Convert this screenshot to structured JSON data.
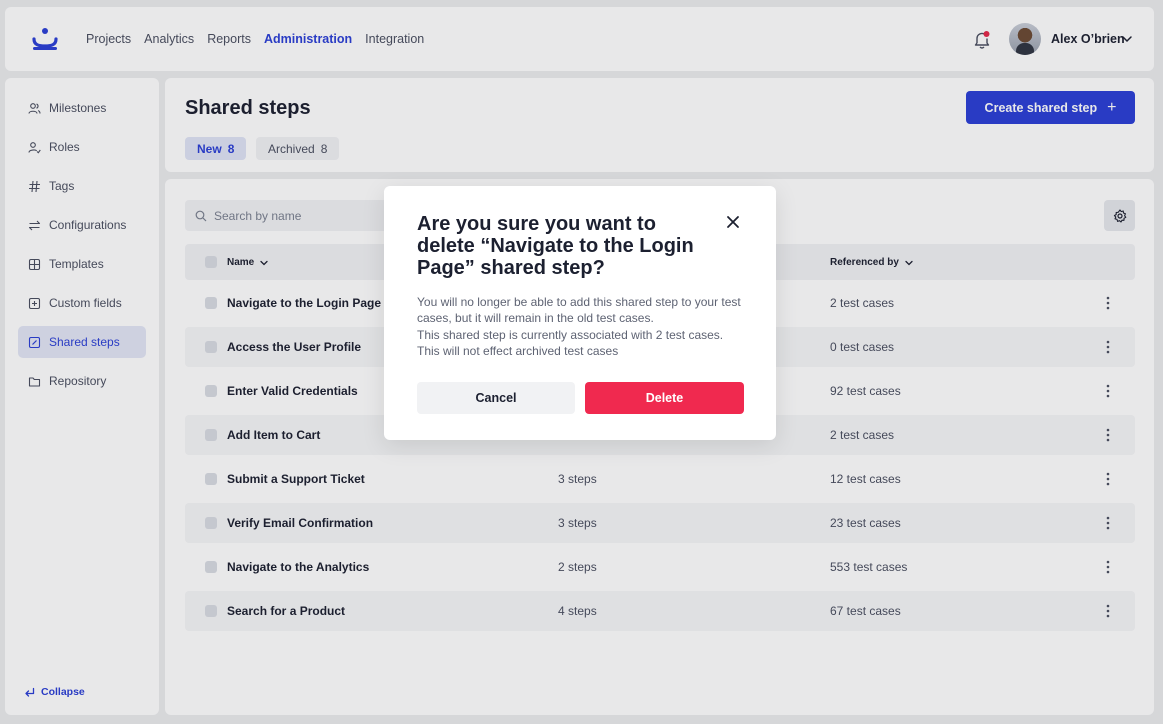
{
  "nav": {
    "items": [
      {
        "label": "Projects",
        "active": false
      },
      {
        "label": "Analytics",
        "active": false
      },
      {
        "label": "Reports",
        "active": false
      },
      {
        "label": "Administration",
        "active": true
      },
      {
        "label": "Integration",
        "active": false
      }
    ],
    "user_name": "Alex O’brien"
  },
  "sidebar": {
    "items": [
      {
        "label": "Milestones",
        "icon": "users-icon"
      },
      {
        "label": "Roles",
        "icon": "user-roles-icon"
      },
      {
        "label": "Tags",
        "icon": "hash-icon"
      },
      {
        "label": "Configurations",
        "icon": "arrows-exchange-icon"
      },
      {
        "label": "Templates",
        "icon": "layout-icon"
      },
      {
        "label": "Custom fields",
        "icon": "plus-square-icon"
      },
      {
        "label": "Shared steps",
        "icon": "edit-square-icon",
        "active": true
      },
      {
        "label": "Repository",
        "icon": "folder-icon"
      }
    ],
    "collapse_label": "Collapse"
  },
  "header": {
    "title": "Shared steps",
    "create_button": "Create shared step",
    "tabs": [
      {
        "label": "New",
        "count": "8",
        "active": true
      },
      {
        "label": "Archived",
        "count": "8",
        "active": false
      }
    ]
  },
  "table": {
    "search_placeholder": "Search by name",
    "columns": {
      "name": "Name",
      "referenced_by": "Referenced by"
    },
    "rows": [
      {
        "name": "Navigate to the Login Page",
        "steps": "",
        "referenced": "2 test cases"
      },
      {
        "name": "Access the User Profile",
        "steps": "",
        "referenced": "0 test cases"
      },
      {
        "name": "Enter Valid Credentials",
        "steps": "",
        "referenced": "92 test cases"
      },
      {
        "name": "Add Item to Cart",
        "steps": "",
        "referenced": "2 test cases"
      },
      {
        "name": "Submit a Support Ticket",
        "steps": "3 steps",
        "referenced": "12 test cases"
      },
      {
        "name": "Verify Email Confirmation",
        "steps": "3 steps",
        "referenced": "23 test cases"
      },
      {
        "name": "Navigate to the Analytics",
        "steps": "2 steps",
        "referenced": "553 test cases"
      },
      {
        "name": "Search for a Product",
        "steps": "4 steps",
        "referenced": "67 test cases"
      }
    ]
  },
  "modal": {
    "title": "Are you sure you want to delete “Navigate to the Login Page” shared step?",
    "body": [
      "You will no longer be able to add this shared step to your test cases, but it will remain in the old test cases.",
      "This shared step is currently associated with 2 test cases.",
      "This will not effect archived test cases"
    ],
    "cancel_label": "Cancel",
    "delete_label": "Delete"
  },
  "colors": {
    "accent": "#2b3fd6",
    "danger": "#f0294f",
    "notification_dot": "#e5294a"
  }
}
